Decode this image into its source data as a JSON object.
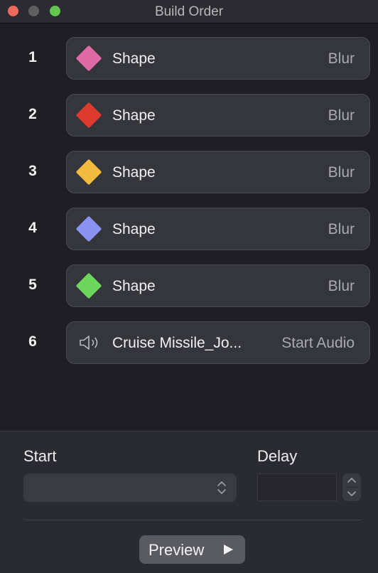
{
  "window": {
    "title": "Build Order"
  },
  "builds": [
    {
      "number": "1",
      "label": "Shape",
      "action": "Blur",
      "icon": "diamond-shape-icon",
      "color": "#e06aa6"
    },
    {
      "number": "2",
      "label": "Shape",
      "action": "Blur",
      "icon": "diamond-shape-icon",
      "color": "#db3a2c"
    },
    {
      "number": "3",
      "label": "Shape",
      "action": "Blur",
      "icon": "diamond-shape-icon",
      "color": "#f2bb3e"
    },
    {
      "number": "4",
      "label": "Shape",
      "action": "Blur",
      "icon": "diamond-shape-icon",
      "color": "#8b93f2"
    },
    {
      "number": "5",
      "label": "Shape",
      "action": "Blur",
      "icon": "diamond-shape-icon",
      "color": "#6dd75c"
    },
    {
      "number": "6",
      "label": "Cruise Missile_Jo...",
      "action": "Start Audio",
      "icon": "speaker-icon"
    }
  ],
  "controls": {
    "start_label": "Start",
    "start_value": "",
    "delay_label": "Delay",
    "delay_value": "",
    "preview_label": "Preview"
  }
}
